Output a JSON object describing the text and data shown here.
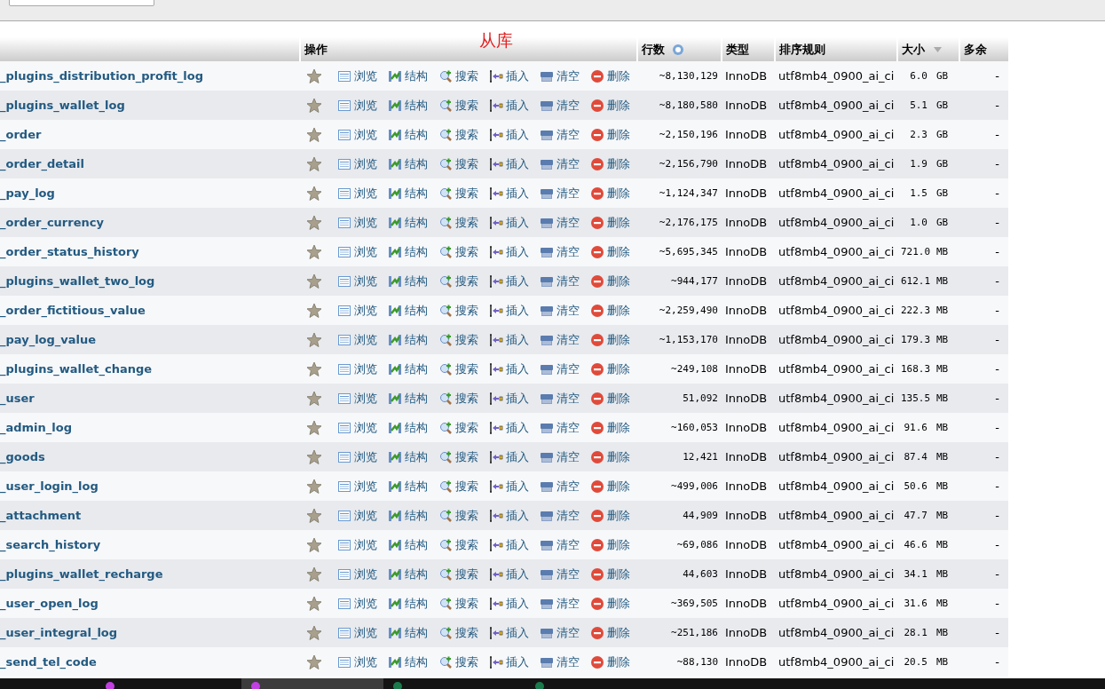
{
  "overlay_label": "从库",
  "columns": [
    {
      "kind": "name"
    },
    {
      "label": "操作",
      "kind": "ops"
    },
    {
      "label": "行数",
      "kind": "rows"
    },
    {
      "label": "类型",
      "kind": "type"
    },
    {
      "label": "排序规则",
      "kind": "collation"
    },
    {
      "label": "大小",
      "kind": "size"
    },
    {
      "label": "多余",
      "kind": "overhead"
    }
  ],
  "rows": [
    {
      "name": "_plugins_distribution_profit_log",
      "actions": [
        "浏览",
        "结构",
        "搜索",
        "插入",
        "清空",
        "删除"
      ],
      "rows": "~8,130,129",
      "type": "InnoDB",
      "collation": "utf8mb4_0900_ai_ci",
      "size": "6.0",
      "unit": "GB",
      "overhead": "-"
    },
    {
      "name": "_plugins_wallet_log",
      "actions": [
        "浏览",
        "结构",
        "搜索",
        "插入",
        "清空",
        "删除"
      ],
      "rows": "~8,180,580",
      "type": "InnoDB",
      "collation": "utf8mb4_0900_ai_ci",
      "size": "5.1",
      "unit": "GB",
      "overhead": "-"
    },
    {
      "name": "_order",
      "actions": [
        "浏览",
        "结构",
        "搜索",
        "插入",
        "清空",
        "删除"
      ],
      "rows": "~2,150,196",
      "type": "InnoDB",
      "collation": "utf8mb4_0900_ai_ci",
      "size": "2.3",
      "unit": "GB",
      "overhead": "-"
    },
    {
      "name": "_order_detail",
      "actions": [
        "浏览",
        "结构",
        "搜索",
        "插入",
        "清空",
        "删除"
      ],
      "rows": "~2,156,790",
      "type": "InnoDB",
      "collation": "utf8mb4_0900_ai_ci",
      "size": "1.9",
      "unit": "GB",
      "overhead": "-"
    },
    {
      "name": "_pay_log",
      "actions": [
        "浏览",
        "结构",
        "搜索",
        "插入",
        "清空",
        "删除"
      ],
      "rows": "~1,124,347",
      "type": "InnoDB",
      "collation": "utf8mb4_0900_ai_ci",
      "size": "1.5",
      "unit": "GB",
      "overhead": "-"
    },
    {
      "name": "_order_currency",
      "actions": [
        "浏览",
        "结构",
        "搜索",
        "插入",
        "清空",
        "删除"
      ],
      "rows": "~2,176,175",
      "type": "InnoDB",
      "collation": "utf8mb4_0900_ai_ci",
      "size": "1.0",
      "unit": "GB",
      "overhead": "-"
    },
    {
      "name": "_order_status_history",
      "actions": [
        "浏览",
        "结构",
        "搜索",
        "插入",
        "清空",
        "删除"
      ],
      "rows": "~5,695,345",
      "type": "InnoDB",
      "collation": "utf8mb4_0900_ai_ci",
      "size": "721.0",
      "unit": "MB",
      "overhead": "-"
    },
    {
      "name": "_plugins_wallet_two_log",
      "actions": [
        "浏览",
        "结构",
        "搜索",
        "插入",
        "清空",
        "删除"
      ],
      "rows": "~944,177",
      "type": "InnoDB",
      "collation": "utf8mb4_0900_ai_ci",
      "size": "612.1",
      "unit": "MB",
      "overhead": "-"
    },
    {
      "name": "_order_fictitious_value",
      "actions": [
        "浏览",
        "结构",
        "搜索",
        "插入",
        "清空",
        "删除"
      ],
      "rows": "~2,259,490",
      "type": "InnoDB",
      "collation": "utf8mb4_0900_ai_ci",
      "size": "222.3",
      "unit": "MB",
      "overhead": "-"
    },
    {
      "name": "_pay_log_value",
      "actions": [
        "浏览",
        "结构",
        "搜索",
        "插入",
        "清空",
        "删除"
      ],
      "rows": "~1,153,170",
      "type": "InnoDB",
      "collation": "utf8mb4_0900_ai_ci",
      "size": "179.3",
      "unit": "MB",
      "overhead": "-"
    },
    {
      "name": "_plugins_wallet_change",
      "actions": [
        "浏览",
        "结构",
        "搜索",
        "插入",
        "清空",
        "删除"
      ],
      "rows": "~249,108",
      "type": "InnoDB",
      "collation": "utf8mb4_0900_ai_ci",
      "size": "168.3",
      "unit": "MB",
      "overhead": "-"
    },
    {
      "name": "_user",
      "actions": [
        "浏览",
        "结构",
        "搜索",
        "插入",
        "清空",
        "删除"
      ],
      "rows": "51,092",
      "type": "InnoDB",
      "collation": "utf8mb4_0900_ai_ci",
      "size": "135.5",
      "unit": "MB",
      "overhead": "-"
    },
    {
      "name": "_admin_log",
      "actions": [
        "浏览",
        "结构",
        "搜索",
        "插入",
        "清空",
        "删除"
      ],
      "rows": "~160,053",
      "type": "InnoDB",
      "collation": "utf8mb4_0900_ai_ci",
      "size": "91.6",
      "unit": "MB",
      "overhead": "-"
    },
    {
      "name": "_goods",
      "actions": [
        "浏览",
        "结构",
        "搜索",
        "插入",
        "清空",
        "删除"
      ],
      "rows": "12,421",
      "type": "InnoDB",
      "collation": "utf8mb4_0900_ai_ci",
      "size": "87.4",
      "unit": "MB",
      "overhead": "-"
    },
    {
      "name": "_user_login_log",
      "actions": [
        "浏览",
        "结构",
        "搜索",
        "插入",
        "清空",
        "删除"
      ],
      "rows": "~499,006",
      "type": "InnoDB",
      "collation": "utf8mb4_0900_ai_ci",
      "size": "50.6",
      "unit": "MB",
      "overhead": "-"
    },
    {
      "name": "_attachment",
      "actions": [
        "浏览",
        "结构",
        "搜索",
        "插入",
        "清空",
        "删除"
      ],
      "rows": "44,909",
      "type": "InnoDB",
      "collation": "utf8mb4_0900_ai_ci",
      "size": "47.7",
      "unit": "MB",
      "overhead": "-"
    },
    {
      "name": "_search_history",
      "actions": [
        "浏览",
        "结构",
        "搜索",
        "插入",
        "清空",
        "删除"
      ],
      "rows": "~69,086",
      "type": "InnoDB",
      "collation": "utf8mb4_0900_ai_ci",
      "size": "46.6",
      "unit": "MB",
      "overhead": "-"
    },
    {
      "name": "_plugins_wallet_recharge",
      "actions": [
        "浏览",
        "结构",
        "搜索",
        "插入",
        "清空",
        "删除"
      ],
      "rows": "44,603",
      "type": "InnoDB",
      "collation": "utf8mb4_0900_ai_ci",
      "size": "34.1",
      "unit": "MB",
      "overhead": "-"
    },
    {
      "name": "_user_open_log",
      "actions": [
        "浏览",
        "结构",
        "搜索",
        "插入",
        "清空",
        "删除"
      ],
      "rows": "~369,505",
      "type": "InnoDB",
      "collation": "utf8mb4_0900_ai_ci",
      "size": "31.6",
      "unit": "MB",
      "overhead": "-"
    },
    {
      "name": "_user_integral_log",
      "actions": [
        "浏览",
        "结构",
        "搜索",
        "插入",
        "清空",
        "删除"
      ],
      "rows": "~251,186",
      "type": "InnoDB",
      "collation": "utf8mb4_0900_ai_ci",
      "size": "28.1",
      "unit": "MB",
      "overhead": "-"
    },
    {
      "name": "_send_tel_code",
      "actions": [
        "浏览",
        "结构",
        "搜索",
        "插入",
        "清空",
        "删除"
      ],
      "rows": "~88,130",
      "type": "InnoDB",
      "collation": "utf8mb4_0900_ai_ci",
      "size": "20.5",
      "unit": "MB",
      "overhead": "-"
    }
  ]
}
